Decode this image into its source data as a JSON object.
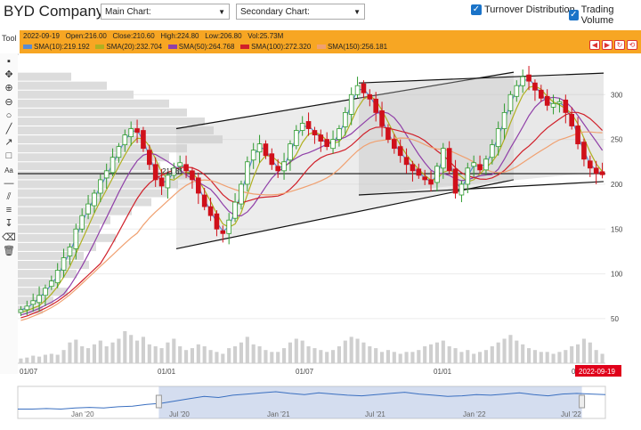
{
  "header": {
    "company": "BYD Company",
    "main_chart_label": "Main Chart:",
    "secondary_chart_label": "Secondary Chart:",
    "turnover_label": "Turnover Distribution",
    "trading_volume_label": "Trading Volume",
    "turnover_checked": true,
    "trading_volume_checked": true
  },
  "tool_label": "Tool",
  "info": {
    "date": "2022-09-19",
    "open": "Open:216.00",
    "close": "Close:210.60",
    "high": "High:224.80",
    "low": "Low:206.80",
    "vol": "Vol:25.73M"
  },
  "sma": [
    {
      "label": "SMA(10):219.192",
      "color": "#5b8bd0"
    },
    {
      "label": "SMA(20):232.704",
      "color": "#b0b020"
    },
    {
      "label": "SMA(50):264.768",
      "color": "#9040a8"
    },
    {
      "label": "SMA(100):272.320",
      "color": "#d0202a"
    },
    {
      "label": "SMA(150):256.181",
      "color": "#f0a070"
    }
  ],
  "toolbar_icons": [
    "pointer-icon",
    "crosshair-icon",
    "zoom-in-icon",
    "zoom-out-icon",
    "circle-icon",
    "line-icon",
    "arrow-icon",
    "rectangle-icon",
    "text-icon",
    "horizontal-line-icon",
    "parallel-lines-icon",
    "fib-icon",
    "vertical-line-icon",
    "eraser-icon",
    "trash-icon"
  ],
  "nav_icons": [
    "prev-icon",
    "next-icon",
    "refresh-icon",
    "reset-icon"
  ],
  "chart_data": {
    "type": "candlestick",
    "y_ticks": [
      50,
      100,
      150,
      200,
      250,
      300
    ],
    "ylim": [
      40,
      340
    ],
    "x_tick_labels": [
      "01/07",
      "01/01",
      "01/07",
      "01/01",
      "01/07"
    ],
    "x_tick_pos": [
      0,
      0.25,
      0.5,
      0.75,
      1.0
    ],
    "annotation_price": "211.81",
    "horizontal_line_value": 211.8,
    "last_date_label": "2022-09-19",
    "closes": [
      60,
      64,
      70,
      76,
      84,
      92,
      104,
      118,
      130,
      150,
      165,
      178,
      190,
      205,
      215,
      230,
      242,
      255,
      262,
      258,
      240,
      222,
      205,
      198,
      210,
      218,
      224,
      215,
      205,
      190,
      175,
      165,
      150,
      145,
      160,
      180,
      200,
      225,
      238,
      245,
      232,
      222,
      215,
      225,
      245,
      260,
      268,
      262,
      255,
      248,
      242,
      250,
      262,
      280,
      300,
      310,
      302,
      295,
      280,
      265,
      250,
      240,
      232,
      222,
      215,
      210,
      205,
      200,
      220,
      240,
      215,
      190,
      200,
      218,
      224,
      216,
      228,
      244,
      262,
      280,
      300,
      310,
      320,
      315,
      305,
      296,
      288,
      290,
      292,
      280,
      265,
      245,
      228,
      218,
      212,
      210.6
    ],
    "volumes": [
      5,
      6,
      8,
      7,
      9,
      10,
      9,
      14,
      22,
      25,
      18,
      16,
      20,
      24,
      18,
      22,
      26,
      34,
      30,
      24,
      28,
      20,
      18,
      16,
      22,
      26,
      18,
      14,
      16,
      20,
      18,
      14,
      12,
      10,
      16,
      18,
      22,
      28,
      20,
      18,
      14,
      12,
      12,
      16,
      22,
      26,
      24,
      18,
      16,
      14,
      12,
      14,
      18,
      24,
      28,
      26,
      22,
      18,
      16,
      12,
      14,
      12,
      10,
      12,
      12,
      14,
      18,
      20,
      22,
      24,
      18,
      16,
      12,
      14,
      10,
      12,
      14,
      18,
      22,
      26,
      30,
      24,
      20,
      16,
      14,
      12,
      12,
      10,
      12,
      14,
      18,
      20,
      26,
      22,
      14,
      10
    ],
    "turnover_profile": [
      [
        60,
        28
      ],
      [
        70,
        40
      ],
      [
        80,
        56
      ],
      [
        90,
        46
      ],
      [
        100,
        66
      ],
      [
        110,
        80
      ],
      [
        120,
        74
      ],
      [
        130,
        88
      ],
      [
        140,
        110
      ],
      [
        150,
        92
      ],
      [
        160,
        104
      ],
      [
        170,
        128
      ],
      [
        180,
        150
      ],
      [
        190,
        168
      ],
      [
        200,
        180
      ],
      [
        210,
        200
      ],
      [
        220,
        160
      ],
      [
        230,
        170
      ],
      [
        240,
        190
      ],
      [
        250,
        230
      ],
      [
        260,
        220
      ],
      [
        270,
        210
      ],
      [
        280,
        190
      ],
      [
        290,
        170
      ],
      [
        300,
        130
      ],
      [
        310,
        100
      ],
      [
        320,
        60
      ]
    ],
    "navigator_labels": [
      "Jan '20",
      "Jul '20",
      "Jan '21",
      "Jul '21",
      "Jan '22",
      "Jul '22"
    ],
    "navigator_values": [
      10,
      10,
      11,
      10,
      12,
      13,
      12,
      14,
      15,
      18,
      20,
      24,
      28,
      32,
      30,
      34,
      36,
      38,
      40,
      37,
      35,
      38,
      36,
      34,
      33,
      35,
      37,
      39,
      36,
      34,
      32,
      33,
      35,
      34,
      36,
      38,
      35,
      33,
      36,
      37,
      36,
      35
    ],
    "navigator_range": [
      0.24,
      0.96
    ]
  }
}
